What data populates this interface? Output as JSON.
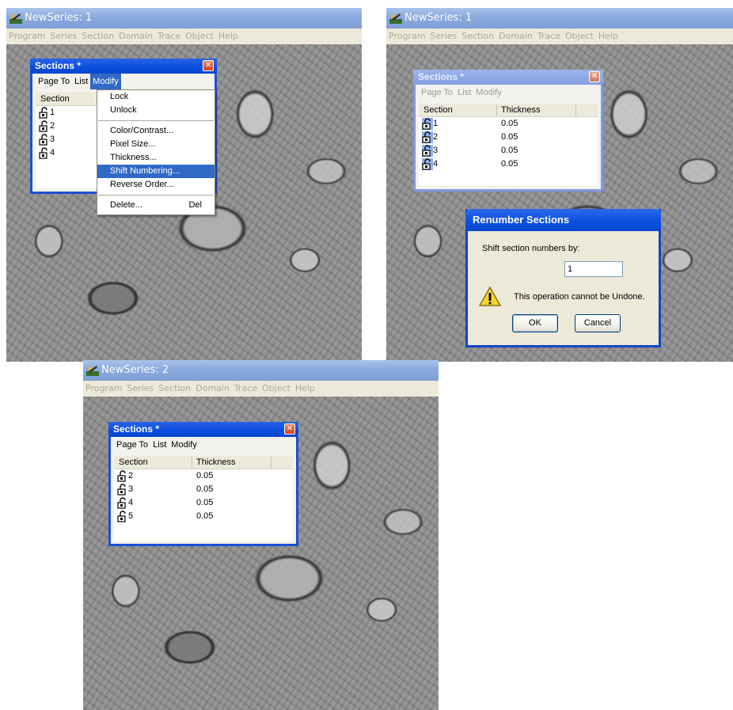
{
  "menubar": [
    "Program",
    "Series",
    "Section",
    "Domain",
    "Trace",
    "Object",
    "Help"
  ],
  "panels": [
    {
      "title": "NewSeries: 1",
      "sections_window": {
        "title": "Sections *",
        "menu": [
          "Page To",
          "List",
          "Modify"
        ],
        "header": {
          "section": "Section",
          "thickness": ""
        },
        "rows": [
          {
            "num": "1",
            "thickness": ""
          },
          {
            "num": "2",
            "thickness": ""
          },
          {
            "num": "3",
            "thickness": ""
          },
          {
            "num": "4",
            "thickness": ""
          }
        ]
      },
      "modify_menu": {
        "items": [
          "Lock",
          "Unlock",
          "Color/Contrast...",
          "Pixel Size...",
          "Thickness...",
          "Shift Numbering...",
          "Reverse Order...",
          "Delete..."
        ],
        "delete_shortcut": "Del",
        "selected": "Shift Numbering..."
      }
    },
    {
      "title": "NewSeries: 1",
      "sections_window": {
        "title": "Sections *",
        "menu": [
          "Page To",
          "List",
          "Modify"
        ],
        "header": {
          "section": "Section",
          "thickness": "Thickness"
        },
        "rows": [
          {
            "num": "1",
            "thickness": "0.05"
          },
          {
            "num": "2",
            "thickness": "0.05"
          },
          {
            "num": "3",
            "thickness": "0.05"
          },
          {
            "num": "4",
            "thickness": "0.05"
          }
        ]
      },
      "dialog": {
        "title": "Renumber Sections",
        "label": "Shift section numbers by:",
        "value": "1",
        "warning": "This operation cannot be Undone.",
        "ok": "OK",
        "cancel": "Cancel"
      }
    },
    {
      "title": "NewSeries: 2",
      "sections_window": {
        "title": "Sections *",
        "menu": [
          "Page To",
          "List",
          "Modify"
        ],
        "header": {
          "section": "Section",
          "thickness": "Thickness"
        },
        "rows": [
          {
            "num": "2",
            "thickness": "0.05"
          },
          {
            "num": "3",
            "thickness": "0.05"
          },
          {
            "num": "4",
            "thickness": "0.05"
          },
          {
            "num": "5",
            "thickness": "0.05"
          }
        ]
      }
    }
  ]
}
